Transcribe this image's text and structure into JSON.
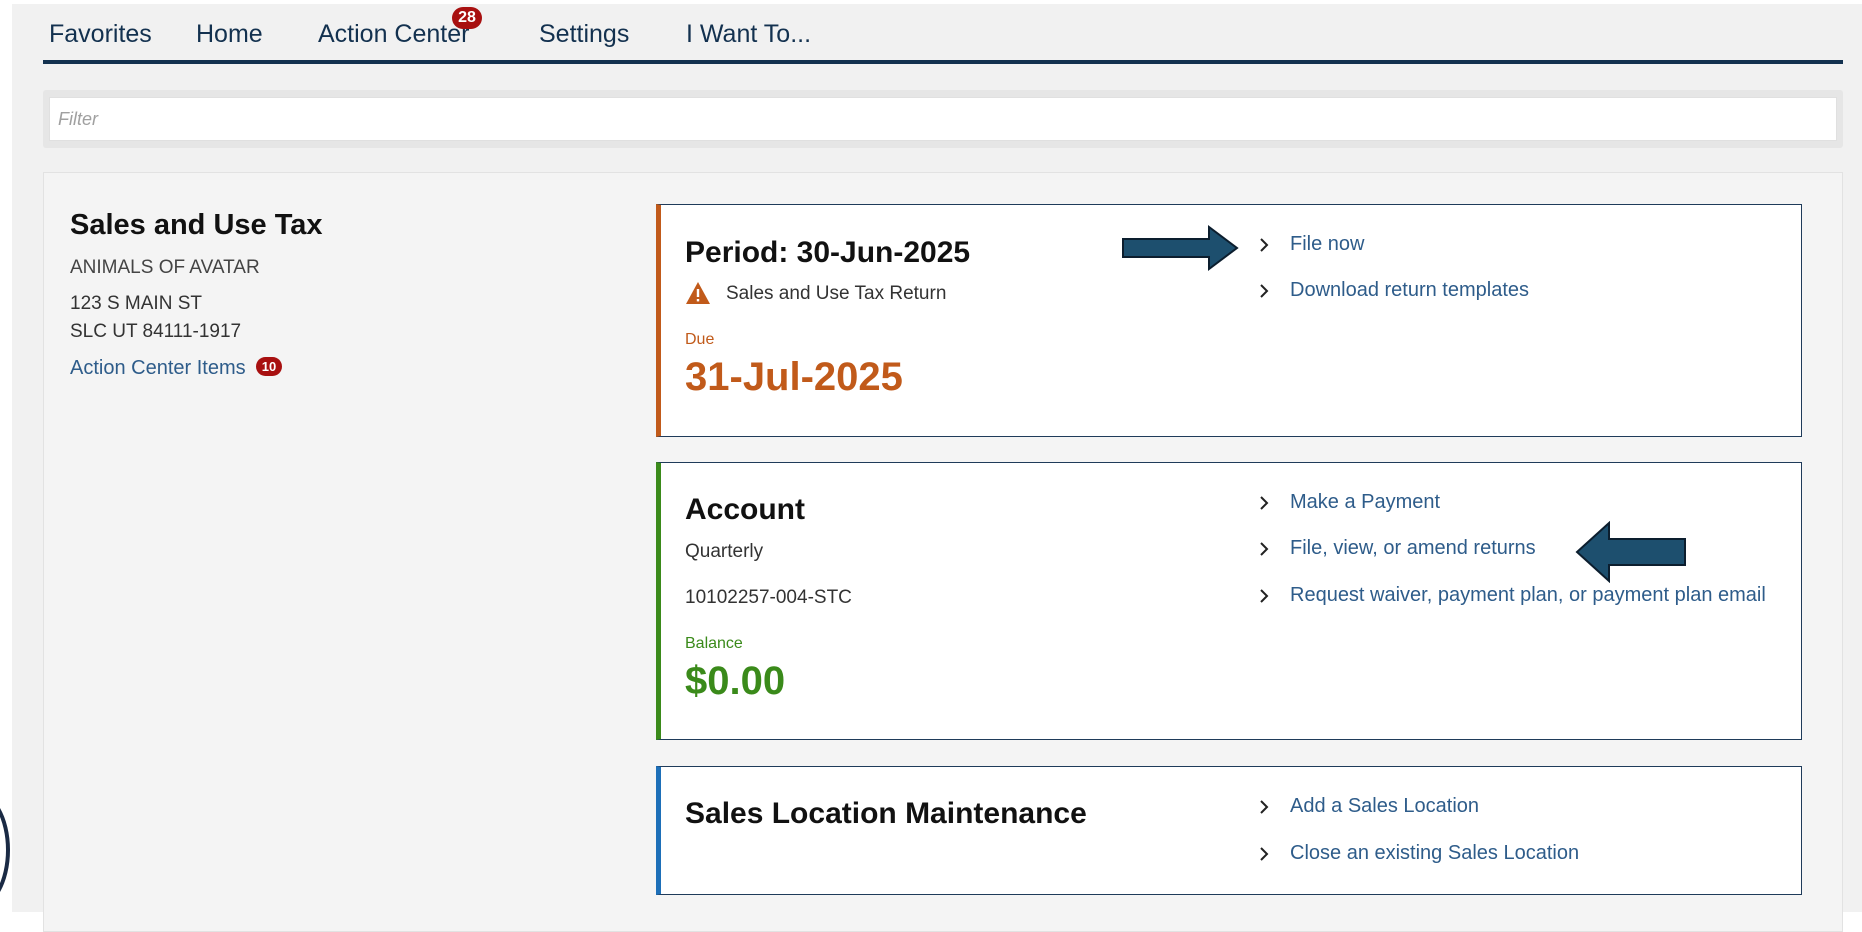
{
  "nav": {
    "items": [
      "Favorites",
      "Home",
      "Action Center",
      "Settings",
      "I Want To..."
    ],
    "action_center_count": "28"
  },
  "filter": {
    "placeholder": "Filter"
  },
  "account_summary": {
    "title": "Sales and Use Tax",
    "name": "ANIMALS OF AVATAR",
    "address_line1": "123 S MAIN ST",
    "address_line2": "SLC UT 84111-1917",
    "action_center_link": "Action Center Items",
    "action_center_count": "10"
  },
  "period_card": {
    "title": "Period: 30-Jun-2025",
    "return_type": "Sales and Use Tax Return",
    "due_label": "Due",
    "due_date": "31-Jul-2025",
    "actions": [
      "File now",
      "Download return templates"
    ]
  },
  "account_card": {
    "title": "Account",
    "frequency": "Quarterly",
    "account_id": "10102257-004-STC",
    "balance_label": "Balance",
    "balance": "$0.00",
    "actions": [
      "Make a Payment",
      "File, view, or amend returns",
      "Request waiver, payment plan, or payment plan email"
    ]
  },
  "location_card": {
    "title": "Sales Location Maintenance",
    "actions": [
      "Add a Sales Location",
      "Close an existing Sales Location"
    ]
  },
  "colors": {
    "nav_text": "#13314f",
    "link": "#2e5c8a",
    "due_accent": "#c15a1a",
    "balance_accent": "#3a8a1a",
    "location_accent": "#1d6fb8",
    "badge": "#a81010",
    "callout_arrow": "#1d4f6e"
  },
  "icons": {
    "warning": "warning-triangle-icon",
    "chevron": "chevron-right-icon",
    "callout": "callout-arrow-icon"
  }
}
